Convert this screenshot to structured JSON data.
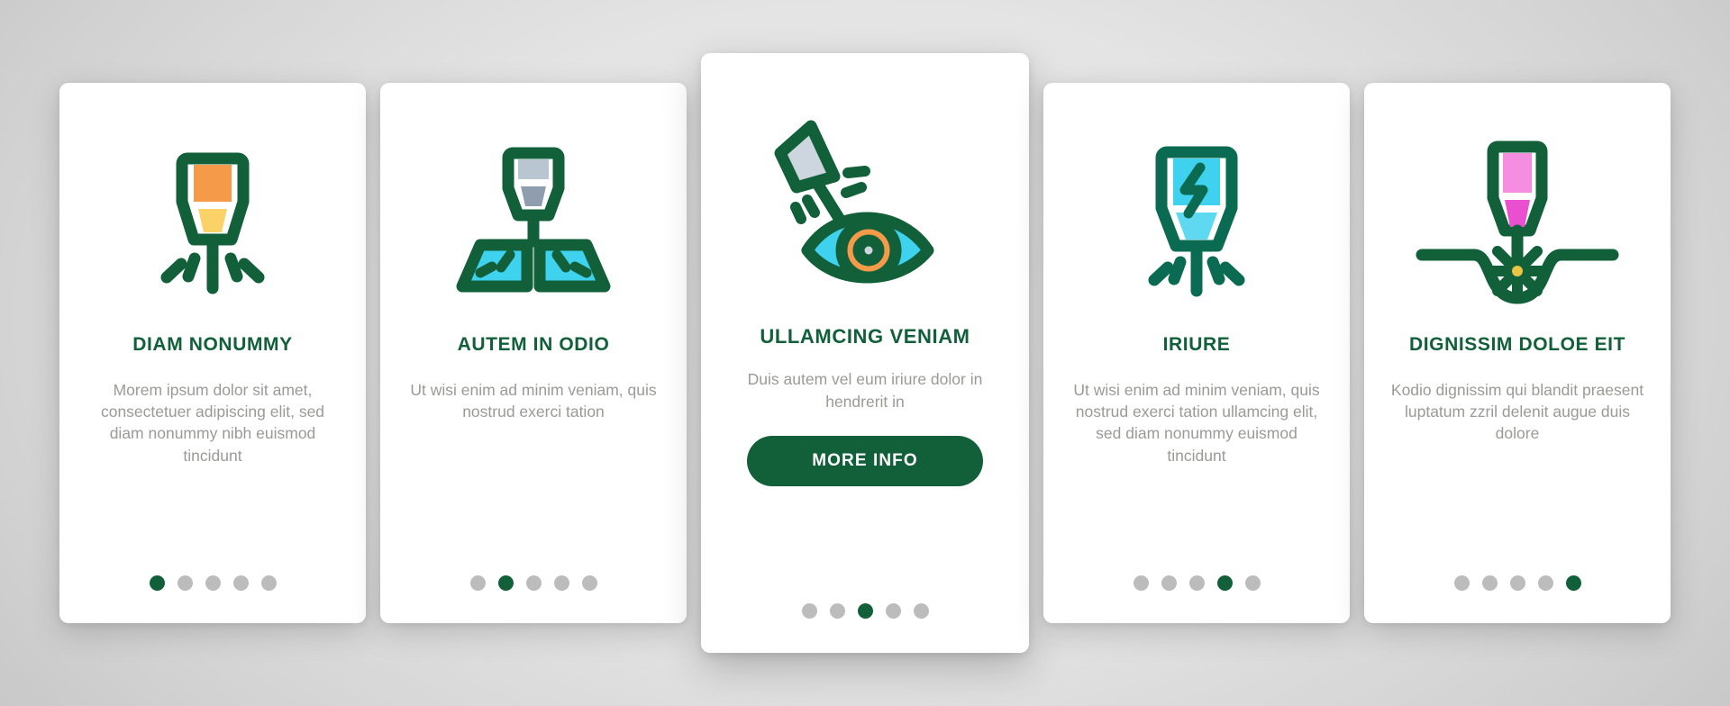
{
  "theme": {
    "brand_green": "#11603a",
    "icon_outline": "#11603a",
    "body_text": "#9a9a96",
    "dot_inactive": "#bcbcbc",
    "card_bg": "#ffffff",
    "page_bg": "#d8d8d8",
    "accent_orange": "#f59a49",
    "accent_yellow": "#fbd268",
    "accent_cyan": "#3fd2ef",
    "accent_grey_blue": "#b9c6d2",
    "accent_pink_light": "#f58ee0",
    "accent_pink": "#ea4fd0"
  },
  "cards": [
    {
      "id": "diam-nonummy",
      "icon": "laser-cutter-orange-icon",
      "title": "DIAM NONUMMY",
      "description": "Morem ipsum dolor sit amet, consectetuer adipiscing elit, sed diam nonummy nibh euismod tincidunt",
      "has_button": false,
      "button_label": "",
      "dots_total": 5,
      "dot_active_index": 0
    },
    {
      "id": "autem-in-odio",
      "icon": "laser-cutting-metal-sheet-icon",
      "title": "AUTEM IN ODIO",
      "description": "Ut wisi enim ad minim veniam, quis nostrud exerci tation",
      "has_button": false,
      "button_label": "",
      "dots_total": 5,
      "dot_active_index": 1
    },
    {
      "id": "ullamcing-veniam",
      "icon": "laser-eye-surgery-icon",
      "title": "ULLAMCING VENIAM",
      "description": "Duis autem vel eum iriure dolor in hendrerit in",
      "has_button": true,
      "button_label": "MORE INFO",
      "dots_total": 5,
      "dot_active_index": 2
    },
    {
      "id": "iriure",
      "icon": "laser-power-bolt-icon",
      "title": "IRIURE",
      "description": "Ut wisi enim ad minim veniam, quis nostrud exerci tation ullamcing elit, sed diam nonummy euismod tincidunt",
      "has_button": false,
      "button_label": "",
      "dots_total": 5,
      "dot_active_index": 3
    },
    {
      "id": "dignissim-doloe-eit",
      "icon": "laser-engraving-surface-icon",
      "title": "DIGNISSIM DOLOE EIT",
      "description": "Kodio dignissim qui blandit praesent luptatum zzril delenit augue duis dolore",
      "has_button": false,
      "button_label": "",
      "dots_total": 5,
      "dot_active_index": 4
    }
  ]
}
